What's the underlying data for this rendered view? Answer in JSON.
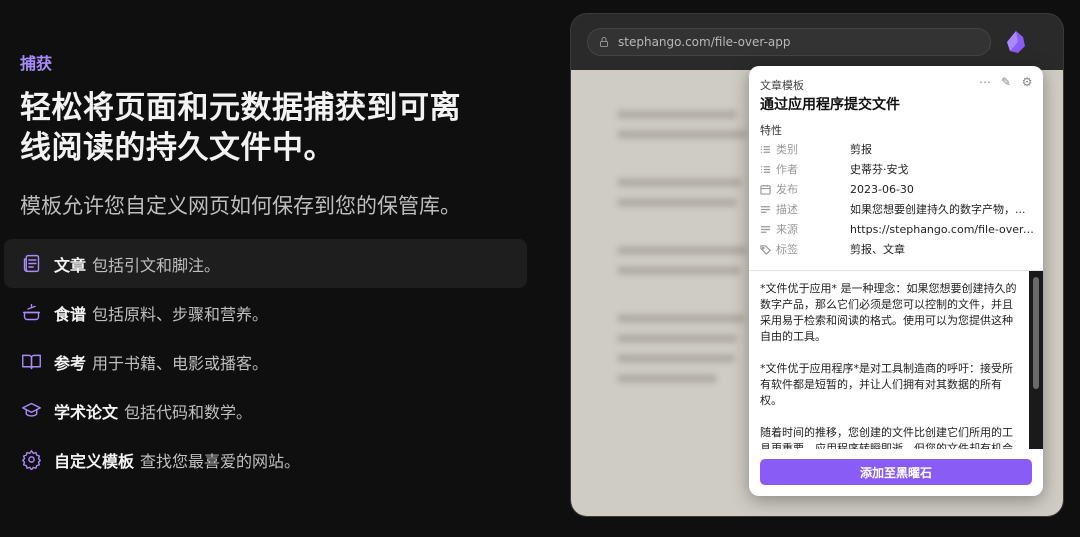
{
  "left": {
    "eyebrow": "捕获",
    "headline_line1": "轻松将页面和元数据捕获到可离",
    "headline_line2": "线阅读的持久文件中。",
    "subhead": "模板允许您自定义网页如何保存到您的保管库。",
    "features": [
      {
        "title": "文章",
        "desc": "包括引文和脚注。",
        "icon": "newspaper-icon",
        "active": true
      },
      {
        "title": "食谱",
        "desc": "包括原料、步骤和营养。",
        "icon": "cooking-pot-icon",
        "active": false
      },
      {
        "title": "参考",
        "desc": "用于书籍、电影或播客。",
        "icon": "open-book-icon",
        "active": false
      },
      {
        "title": "学术论文",
        "desc": "包括代码和数学。",
        "icon": "graduation-cap-icon",
        "active": false
      },
      {
        "title": "自定义模板",
        "desc": "查找您最喜爱的网站。",
        "icon": "gear-icon",
        "active": false
      }
    ]
  },
  "browser": {
    "url": "stephango.com/file-over-app",
    "accent": "#8a5cf6"
  },
  "panel": {
    "template_label": "文章模板",
    "title": "通过应用程序提交文件",
    "properties_heading": "特性",
    "properties": [
      {
        "key": "类别",
        "value": "剪报",
        "icon": "list-icon"
      },
      {
        "key": "作者",
        "value": "史蒂芬·安戈",
        "icon": "list-icon"
      },
      {
        "key": "发布",
        "value": "2023-06-30",
        "icon": "calendar-icon"
      },
      {
        "key": "描述",
        "value": "如果您想要创建持久的数字产物，...",
        "icon": "text-icon"
      },
      {
        "key": "来源",
        "value": "https://stephango.com/file-over-...",
        "icon": "text-icon"
      },
      {
        "key": "标签",
        "value": "剪报、文章",
        "icon": "tags-icon"
      }
    ],
    "content": [
      "*文件优于应用* 是一种理念：如果您想要创建持久的数字产品，那么它们必须是您可以控制的文件，并且采用易于检索和阅读的格式。使用可以为您提供这种自由的工具。",
      "*文件优于应用程序*是对工具制造商的呼吁：接受所有软件都是短暂的，并让人们拥有对其数据的所有权。",
      "随着时间的推移，您创建的文件比创建它们所用的工具更重要。应用程序转瞬即逝，但您的文件却有机会"
    ],
    "add_button": "添加至黑曜石"
  }
}
